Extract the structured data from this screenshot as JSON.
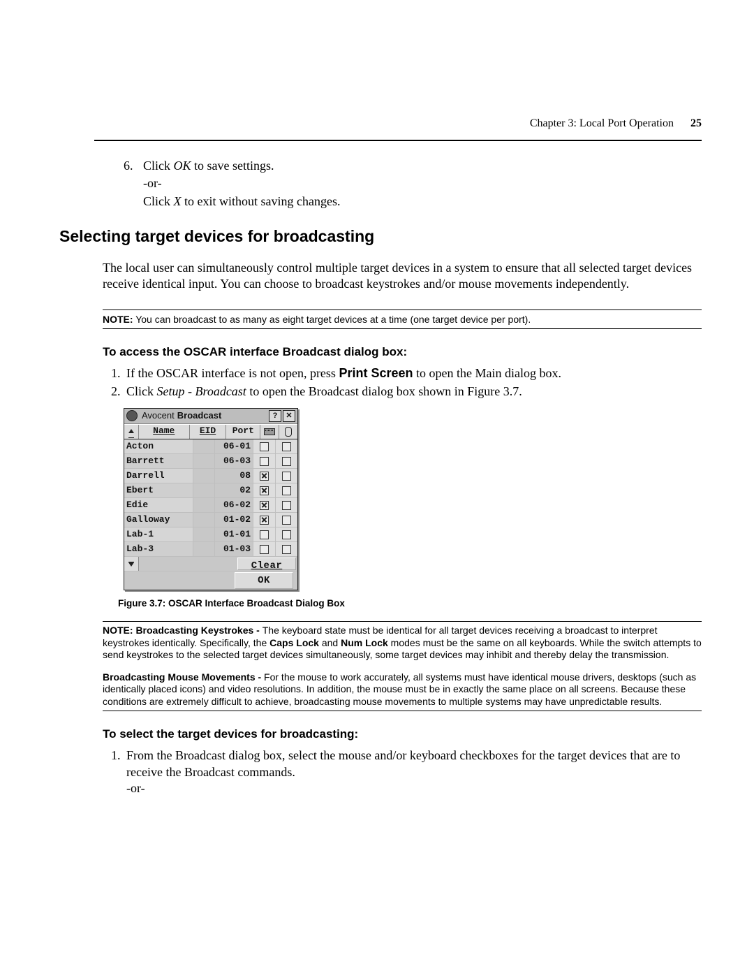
{
  "header": {
    "chapter": "Chapter 3: Local Port Operation",
    "page": "25"
  },
  "step6": {
    "num": "6.",
    "line1_a": "Click ",
    "line1_i": "OK",
    "line1_b": " to save settings.",
    "line2": "-or-",
    "line3_a": "Click ",
    "line3_i": "X",
    "line3_b": " to exit without saving changes."
  },
  "h1": "Selecting target devices for broadcasting",
  "para1": "The local user can simultaneously control multiple target devices in a system to ensure that all selected target devices receive identical input. You can choose to broadcast keystrokes and/or mouse movements independently.",
  "note1": {
    "label": "NOTE:",
    "text": " You can broadcast to as many as eight target devices at a time (one target device per port)."
  },
  "h2a": "To access the OSCAR interface Broadcast dialog box:",
  "steps_a": [
    {
      "pre": "If the OSCAR interface is not open, press ",
      "bold": "Print Screen",
      "post": " to open the Main dialog box."
    },
    {
      "pre": "Click ",
      "ital": "Setup - Broadcast",
      "post": " to open the Broadcast dialog box shown in Figure 3.7."
    }
  ],
  "dialog": {
    "brand": "Avocent",
    "title": "Broadcast",
    "columns": {
      "name": "Name",
      "eid": "EID",
      "port": "Port"
    },
    "rows": [
      {
        "name": "Acton",
        "port": "06-01",
        "kb": false,
        "ms": false
      },
      {
        "name": "Barrett",
        "port": "06-03",
        "kb": false,
        "ms": false
      },
      {
        "name": "Darrell",
        "port": "08",
        "kb": true,
        "ms": false
      },
      {
        "name": "Ebert",
        "port": "02",
        "kb": true,
        "ms": false
      },
      {
        "name": "Edie",
        "port": "06-02",
        "kb": true,
        "ms": false
      },
      {
        "name": "Galloway",
        "port": "01-02",
        "kb": true,
        "ms": false
      },
      {
        "name": "Lab-1",
        "port": "01-01",
        "kb": false,
        "ms": false
      },
      {
        "name": "Lab-3",
        "port": "01-03",
        "kb": false,
        "ms": false
      }
    ],
    "buttons": {
      "clear": "Clear",
      "ok": "OK"
    }
  },
  "caption": "Figure 3.7: OSCAR Interface Broadcast Dialog Box",
  "note2": {
    "label": "NOTE: Broadcasting Keystrokes - ",
    "text_a": "The keyboard state must be identical for all target devices receiving a broadcast to interpret keystrokes identically. Specifically, the ",
    "b1": "Caps Lock",
    "text_b": " and ",
    "b2": "Num Lock",
    "text_c": " modes must be the same on all keyboards. While the switch attempts to send keystrokes to the selected target devices simultaneously, some target devices may inhibit and thereby delay the transmission."
  },
  "note3": {
    "label": "Broadcasting Mouse Movements - ",
    "text": "For the mouse to work accurately, all systems must have identical mouse drivers, desktops (such as identically placed icons) and video resolutions. In addition, the mouse must be in exactly the same place on all screens. Because these conditions are extremely difficult to achieve, broadcasting mouse movements to multiple systems may have unpredictable results."
  },
  "h2b": "To select the target devices for broadcasting:",
  "steps_b": [
    {
      "text": "From the Broadcast dialog box, select the mouse and/or keyboard checkboxes for the target devices that are to receive the Broadcast commands.",
      "or": "-or-"
    }
  ]
}
